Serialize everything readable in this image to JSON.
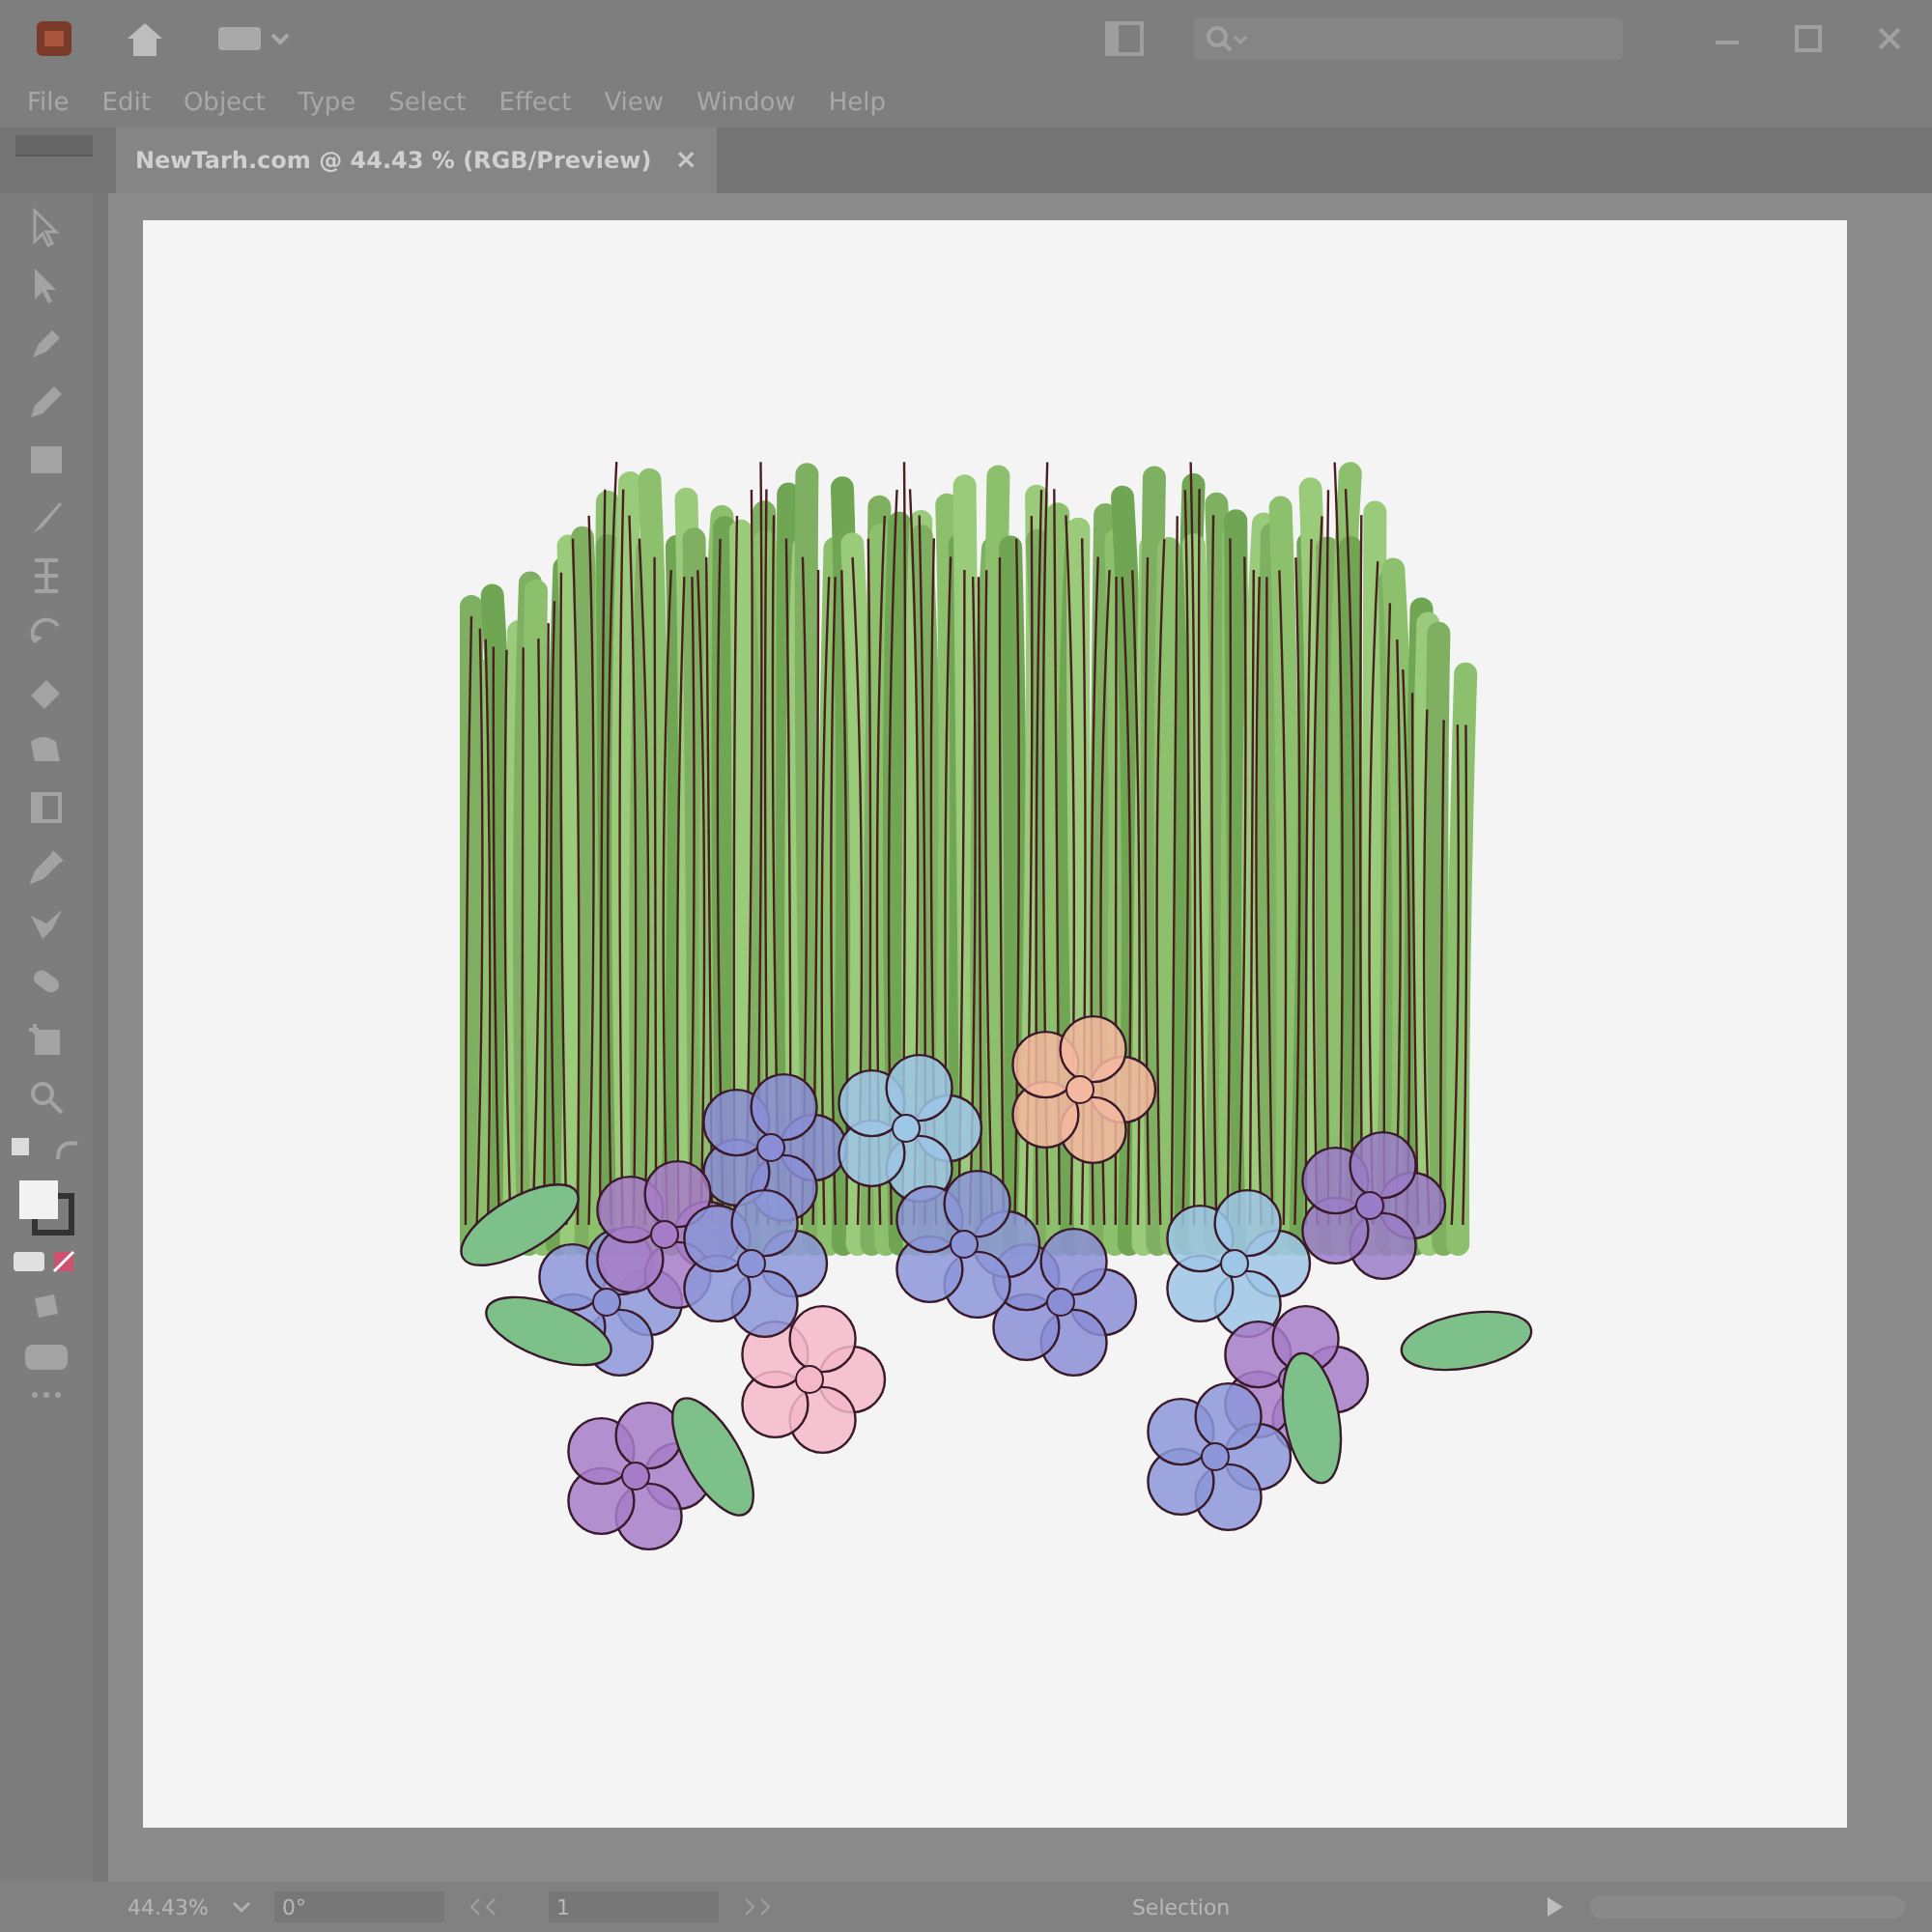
{
  "window": {
    "menu": [
      "File",
      "Edit",
      "Object",
      "Type",
      "Select",
      "Effect",
      "View",
      "Window",
      "Help"
    ]
  },
  "tabs": [
    {
      "label": "NewTarh.com @ 44.43 % (RGB/Preview)",
      "selected": true,
      "close": "×"
    }
  ],
  "status_bar": {
    "zoom": "44.43%",
    "rotation": "0°",
    "artboard": "1",
    "tool": "Selection"
  }
}
